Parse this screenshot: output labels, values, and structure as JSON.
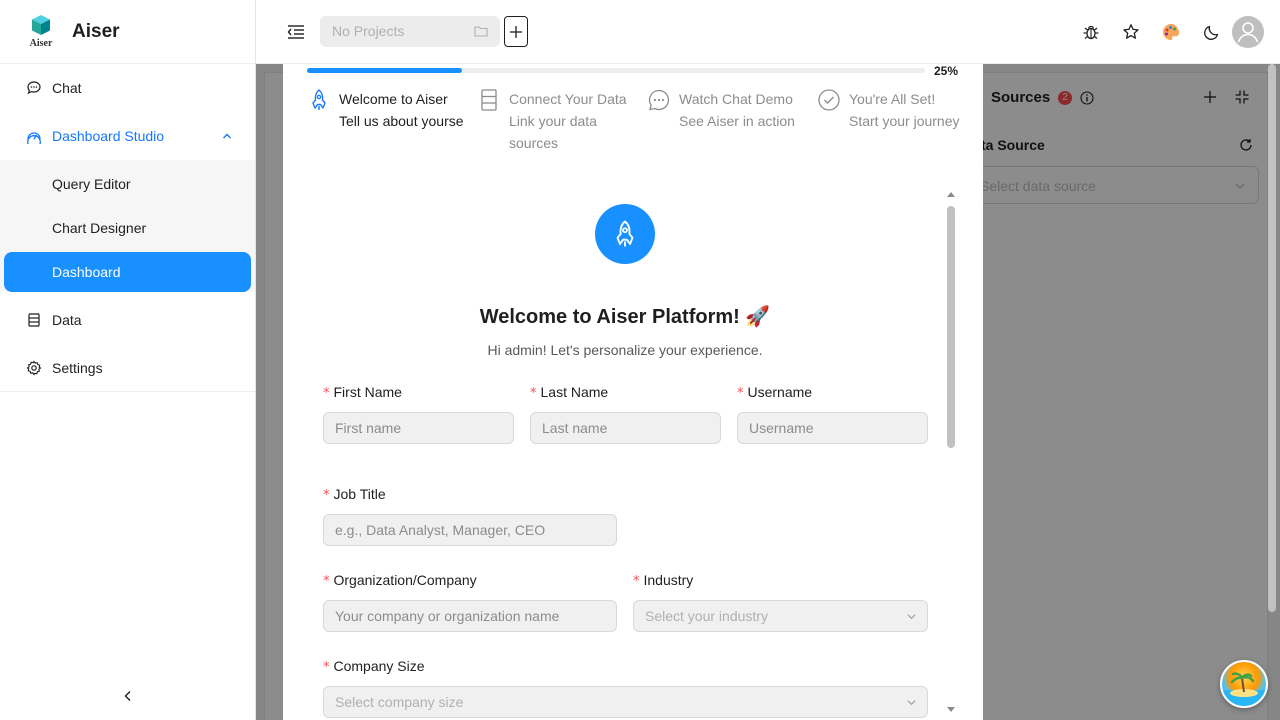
{
  "app": {
    "name": "Aiser",
    "logo_text": "Aiser"
  },
  "sidebar": {
    "items": [
      {
        "label": "Chat",
        "icon": "chat-icon"
      },
      {
        "label": "Dashboard Studio",
        "icon": "dashboard-icon",
        "expanded": true
      },
      {
        "label": "Data",
        "icon": "database-icon"
      },
      {
        "label": "Settings",
        "icon": "gear-icon"
      }
    ],
    "submenu": [
      {
        "label": "Query Editor"
      },
      {
        "label": "Chart Designer"
      },
      {
        "label": "Dashboard",
        "active": true
      }
    ]
  },
  "header": {
    "project_placeholder": "No Projects"
  },
  "data_sources_panel": {
    "title": "Sources",
    "badge": "2",
    "section_label": "ta Source",
    "select_placeholder": "Select data source"
  },
  "onboarding": {
    "progress_percent": 25,
    "progress_label": "25%",
    "steps": [
      {
        "title": "Welcome to Aiser",
        "description": "Tell us about yourse",
        "active": true
      },
      {
        "title": "Connect Your Data",
        "description": "Link your data sources",
        "active": false
      },
      {
        "title": "Watch Chat Demo",
        "description": "See Aiser in action",
        "active": false
      },
      {
        "title": "You're All Set!",
        "description": "Start your journey",
        "active": false
      }
    ],
    "title": "Welcome to Aiser Platform! 🚀",
    "subtitle": "Hi admin! Let's personalize your experience.",
    "fields": {
      "first_name": {
        "label": "First Name",
        "placeholder": "First name",
        "value": ""
      },
      "last_name": {
        "label": "Last Name",
        "placeholder": "Last name",
        "value": ""
      },
      "username": {
        "label": "Username",
        "placeholder": "Username",
        "value": ""
      },
      "job_title": {
        "label": "Job Title",
        "placeholder": "e.g., Data Analyst, Manager, CEO",
        "value": ""
      },
      "organization": {
        "label": "Organization/Company",
        "placeholder": "Your company or organization name",
        "value": ""
      },
      "industry": {
        "label": "Industry",
        "placeholder": "Select your industry"
      },
      "company_size": {
        "label": "Company Size",
        "placeholder": "Select company size"
      }
    },
    "required_mark": "*"
  },
  "colors": {
    "primary": "#1890ff",
    "required": "#ff4d4f",
    "overlay": "rgba(0,0,0,0.45)"
  }
}
